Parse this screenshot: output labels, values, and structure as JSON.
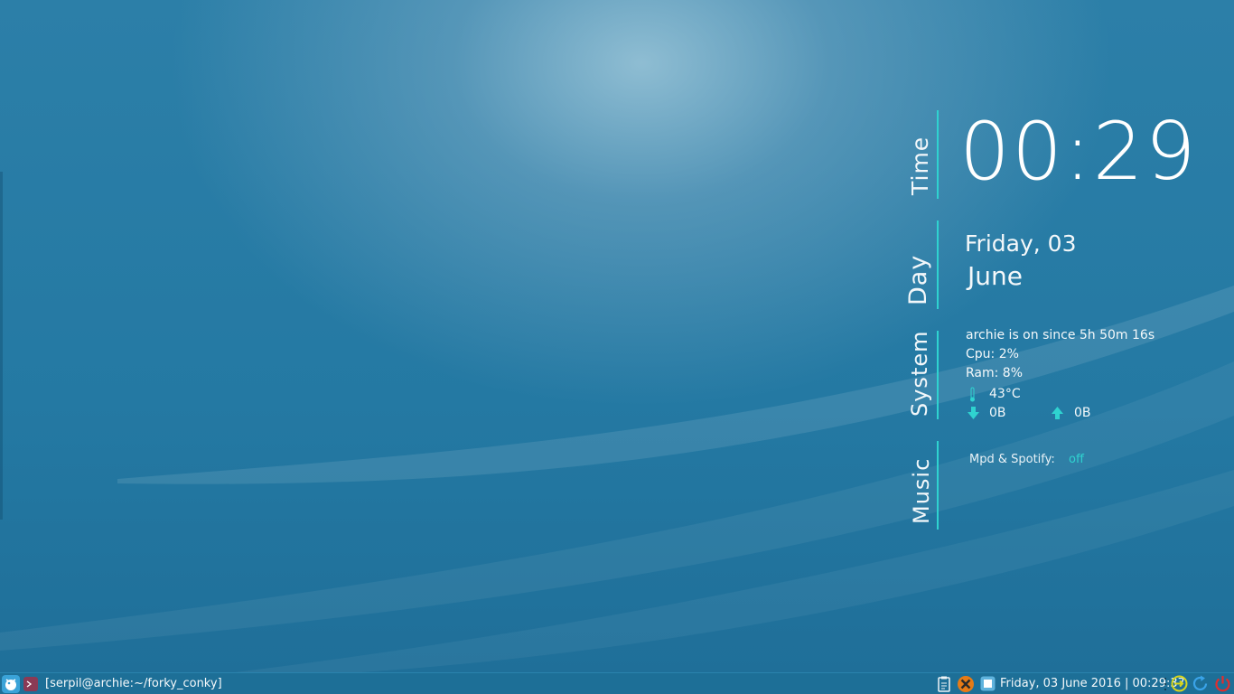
{
  "conky": {
    "time": {
      "label": "Time",
      "value": "00:29"
    },
    "day": {
      "label": "Day",
      "weekday_date": "Friday, 03",
      "month": "June"
    },
    "system": {
      "label": "System",
      "uptime": "archie is on since 5h 50m 16s",
      "cpu": "Cpu: 2%",
      "ram": "Ram: 8%",
      "temperature": "43°C",
      "download": "0B",
      "upload": "0B"
    },
    "music": {
      "label": "Music",
      "source_label": "Mpd & Spotify:",
      "status": "off"
    }
  },
  "taskbar": {
    "window_title": "[serpil@archie:~/forky_conky]",
    "clock": "Friday, 03 June 2016 | 00:29:37",
    "icons": [
      "menu-icon",
      "terminal-icon",
      "clipboard-icon",
      "xfce-icon",
      "screenshot-icon",
      "logout-icon",
      "restart-icon",
      "power-icon"
    ]
  },
  "colors": {
    "accent": "#2fd3d0",
    "desktop_blue": "#2479a3",
    "taskbar": "#1d6f97"
  }
}
